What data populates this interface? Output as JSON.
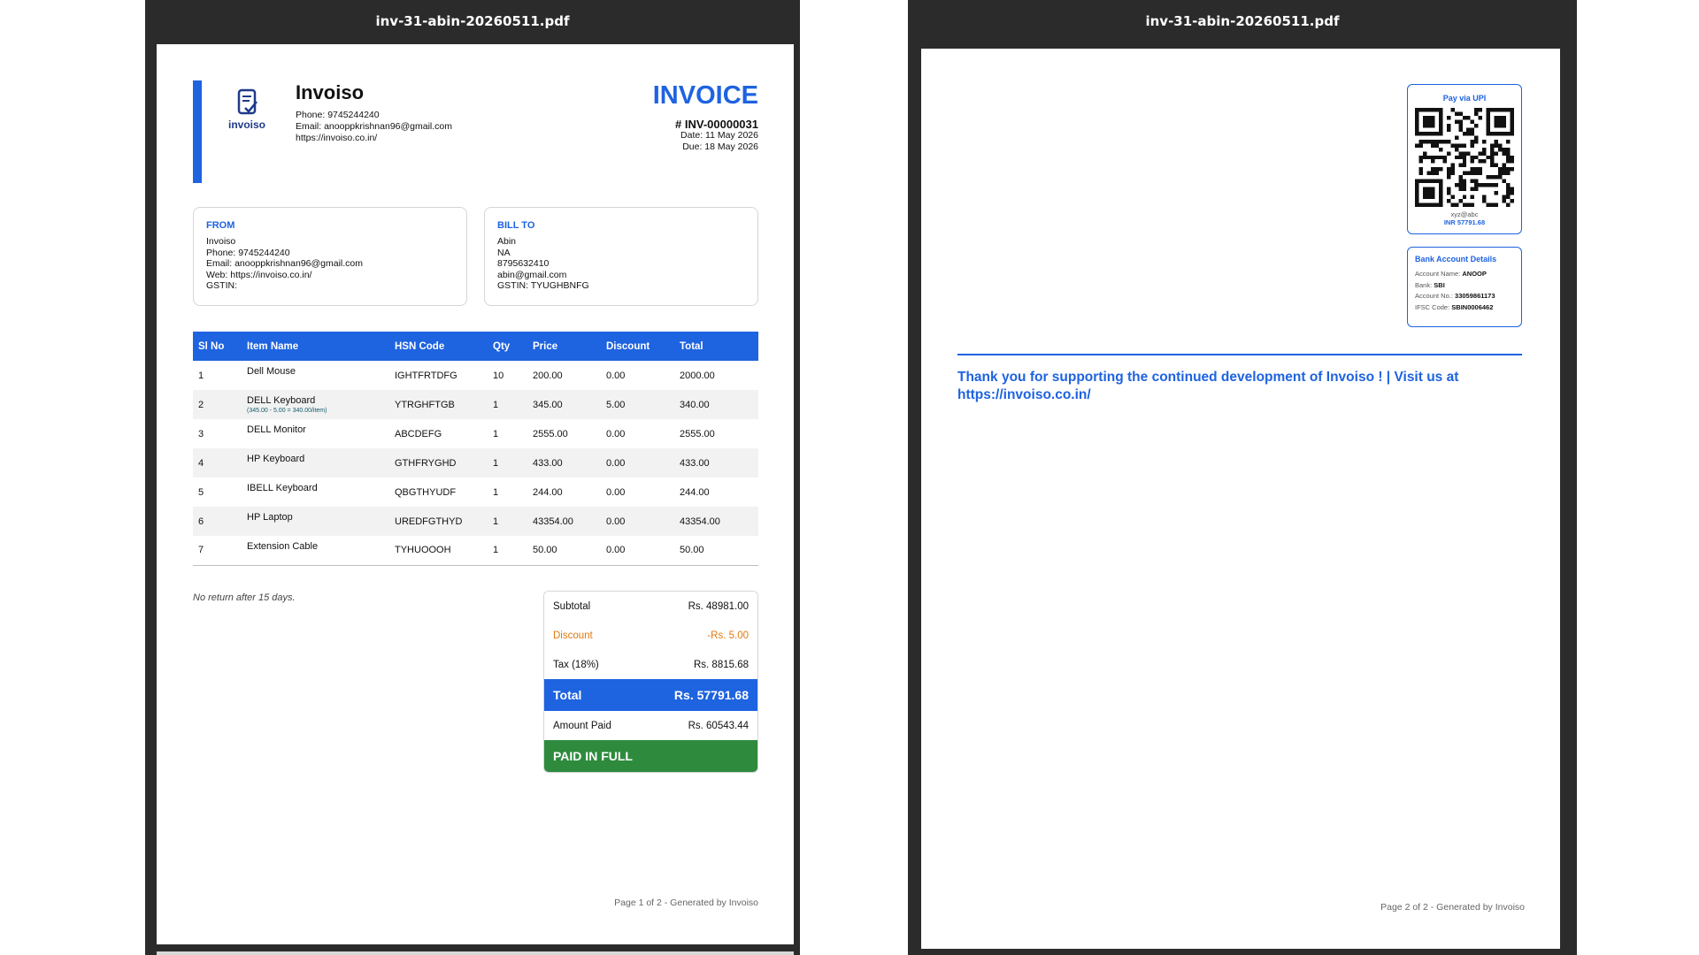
{
  "pdf": {
    "filename": "inv-31-abin-20260511.pdf"
  },
  "colors": {
    "brand_blue": "#1e63e0",
    "paid_green": "#2e8b3e",
    "discount_orange": "#e07a10"
  },
  "company": {
    "logo_text": "invoiso",
    "name": "Invoiso",
    "phone": "Phone: 9745244240",
    "email": "Email: anooppkrishnan96@gmail.com",
    "web": "https://invoiso.co.in/"
  },
  "invoice": {
    "title": "INVOICE",
    "number": "# INV-00000031",
    "date": "Date: 11 May 2026",
    "due": "Due: 18 May 2026"
  },
  "from": {
    "label": "FROM",
    "lines": [
      "Invoiso",
      "Phone: 9745244240",
      "Email: anooppkrishnan96@gmail.com",
      "Web: https://invoiso.co.in/",
      "GSTIN:"
    ]
  },
  "bill_to": {
    "label": "BILL TO",
    "lines": [
      "Abin",
      "NA",
      "8795632410",
      "abin@gmail.com",
      "GSTIN: TYUGHBNFG"
    ]
  },
  "items_table": {
    "headers": [
      "Sl No",
      "Item Name",
      "HSN Code",
      "Qty",
      "Price",
      "Discount",
      "Total"
    ],
    "rows": [
      {
        "sl": "1",
        "name": "Dell Mouse",
        "sub": "",
        "hsn": "IGHTFRTDFG",
        "qty": "10",
        "price": "200.00",
        "discount": "0.00",
        "total": "2000.00"
      },
      {
        "sl": "2",
        "name": "DELL Keyboard",
        "sub": "(345.00 - 5.00 = 340.00/item)",
        "hsn": "YTRGHFTGB",
        "qty": "1",
        "price": "345.00",
        "discount": "5.00",
        "total": "340.00"
      },
      {
        "sl": "3",
        "name": "DELL Monitor",
        "sub": "",
        "hsn": "ABCDEFG",
        "qty": "1",
        "price": "2555.00",
        "discount": "0.00",
        "total": "2555.00"
      },
      {
        "sl": "4",
        "name": "HP Keyboard",
        "sub": "",
        "hsn": "GTHFRYGHD",
        "qty": "1",
        "price": "433.00",
        "discount": "0.00",
        "total": "433.00"
      },
      {
        "sl": "5",
        "name": "IBELL Keyboard",
        "sub": "",
        "hsn": "QBGTHYUDF",
        "qty": "1",
        "price": "244.00",
        "discount": "0.00",
        "total": "244.00"
      },
      {
        "sl": "6",
        "name": "HP Laptop",
        "sub": "",
        "hsn": "UREDFGTHYD",
        "qty": "1",
        "price": "43354.00",
        "discount": "0.00",
        "total": "43354.00"
      },
      {
        "sl": "7",
        "name": "Extension Cable",
        "sub": "",
        "hsn": "TYHUOOOH",
        "qty": "1",
        "price": "50.00",
        "discount": "0.00",
        "total": "50.00"
      }
    ]
  },
  "note": "No return after 15 days.",
  "totals": {
    "subtotal_label": "Subtotal",
    "subtotal": "Rs. 48981.00",
    "discount_label": "Discount",
    "discount": "-Rs. 5.00",
    "tax_label": "Tax (18%)",
    "tax": "Rs. 8815.68",
    "total_label": "Total",
    "total": "Rs. 57791.68",
    "paid_label": "Amount Paid",
    "paid": "Rs. 60543.44",
    "status": "PAID IN FULL"
  },
  "footer_page1": "Page 1 of 2  -  Generated by Invoiso",
  "footer_page2": "Page 2 of 2  -  Generated by Invoiso",
  "upi": {
    "title": "Pay via UPI",
    "id": "xyz@abc",
    "amount": "INR 57791.68"
  },
  "bank": {
    "title": "Bank Account Details",
    "account_name_label": "Account Name:",
    "account_name": "ANOOP",
    "bank_label": "Bank:",
    "bank": "SBI",
    "account_no_label": "Account No.:",
    "account_no": "33059861173",
    "ifsc_label": "IFSC Code:",
    "ifsc": "SBIN0006462"
  },
  "thanks": "Thank you for supporting the continued development of Invoiso ! | Visit us at https://invoiso.co.in/"
}
